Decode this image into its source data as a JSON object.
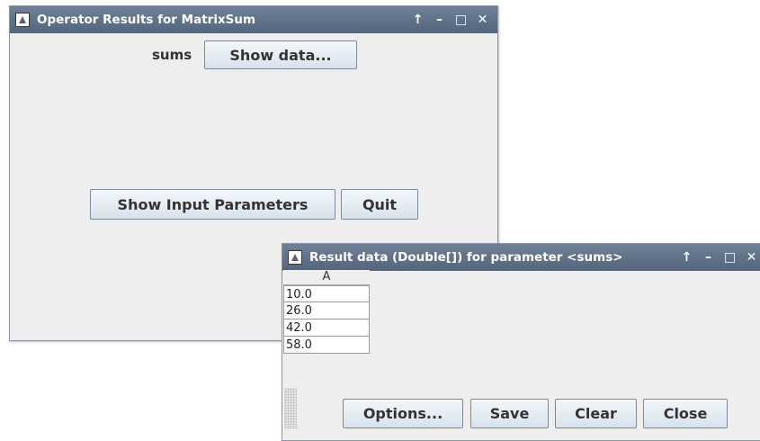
{
  "main_window": {
    "title": "Operator Results for MatrixSum",
    "controls": [
      "↑",
      "–",
      "□",
      "✕"
    ],
    "sums_label": "sums",
    "show_data_label": "Show data...",
    "show_input_label": "Show Input Parameters",
    "quit_label": "Quit"
  },
  "result_window": {
    "title": "Result data (Double[]) for parameter <sums>",
    "controls": [
      "↑",
      "–",
      "□",
      "✕"
    ],
    "table": {
      "column_header": "A",
      "rows": [
        "10.0",
        "26.0",
        "42.0",
        "58.0"
      ]
    },
    "buttons": {
      "options": "Options...",
      "save": "Save",
      "clear": "Clear",
      "close": "Close"
    }
  },
  "colors": {
    "titlebar": "#5f7087",
    "window_bg": "#eeeeee",
    "button_face": "#e3ebf3"
  }
}
